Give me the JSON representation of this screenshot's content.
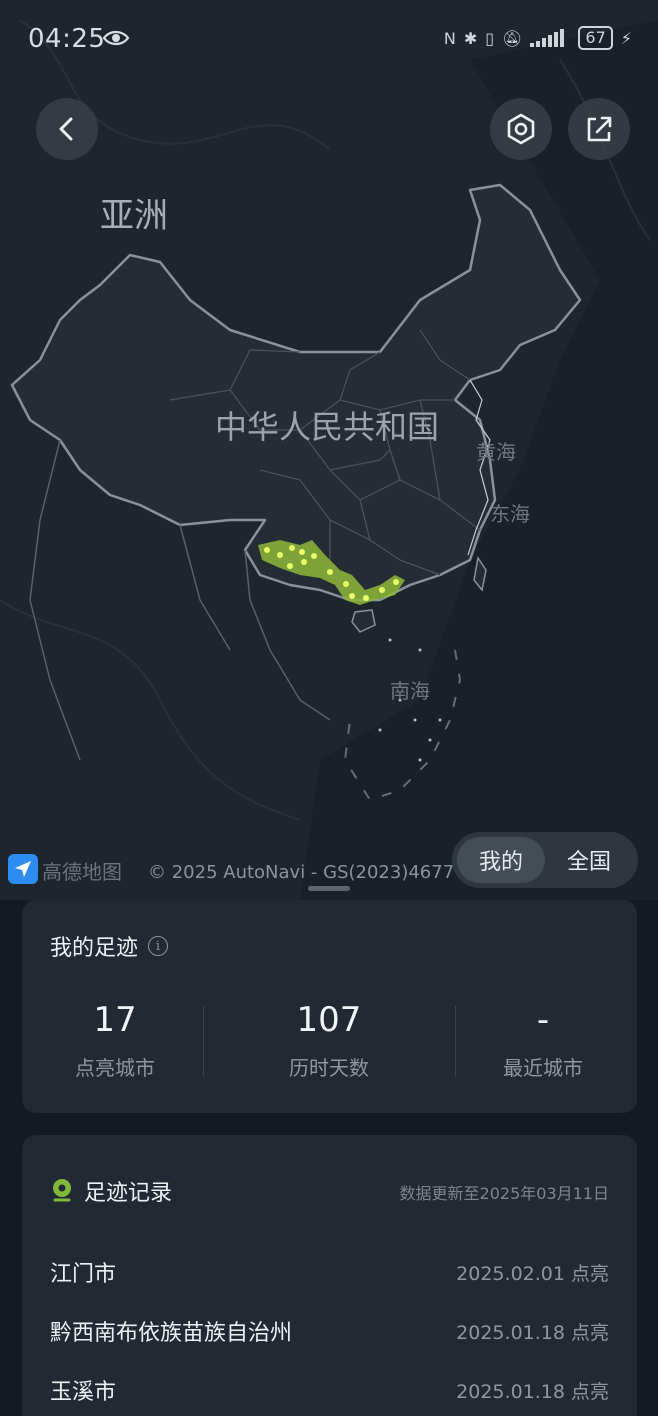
{
  "status_bar": {
    "time": "04:25",
    "battery": "67"
  },
  "map": {
    "labels": {
      "continent": "亚洲",
      "country": "中华人民共和国",
      "yellow_sea": "黄海",
      "east_sea": "东海",
      "south_sea": "南海"
    },
    "provider_name": "高德地图",
    "copyright": "© 2025 AutoNavi - GS(2023)4677号",
    "colors": {
      "background": "#1f252d",
      "land_border": "#8a9099",
      "footprint": "#9bc83a",
      "footprint_dot": "#e8ff6a"
    }
  },
  "top_controls": {
    "back_icon": "chevron-left-icon",
    "settings_icon": "hexagon-settings-icon",
    "share_icon": "share-icon"
  },
  "toggle": {
    "mine": "我的",
    "nationwide": "全国",
    "selected": "我的"
  },
  "summary": {
    "title": "我的足迹",
    "stats": [
      {
        "value": "17",
        "label": "点亮城市"
      },
      {
        "value": "107",
        "label": "历时天数"
      },
      {
        "value": "-",
        "label": "最近城市"
      }
    ]
  },
  "records": {
    "title": "足迹记录",
    "updated": "数据更新至2025年03月11日",
    "items": [
      {
        "city": "江门市",
        "date": "2025.02.01 点亮"
      },
      {
        "city": "黔西南布依族苗族自治州",
        "date": "2025.01.18 点亮"
      },
      {
        "city": "玉溪市",
        "date": "2025.01.18 点亮"
      }
    ]
  }
}
